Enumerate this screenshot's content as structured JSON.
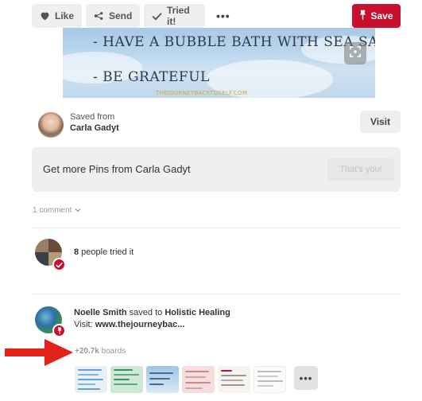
{
  "toolbar": {
    "like_label": "Like",
    "send_label": "Send",
    "tried_label": "Tried it!",
    "more_label": "•••",
    "save_label": "Save"
  },
  "pin_image": {
    "line1": "- HAVE A BUBBLE BATH WITH SEA SALT",
    "line2": "- BE GRATEFUL",
    "watermark": "THEJOURNEYBACKTOSELF.COM"
  },
  "saved_from": {
    "label": "Saved from",
    "name": "Carla Gadyt",
    "visit_label": "Visit"
  },
  "more_pins": {
    "text": "Get more Pins from Carla Gadyt",
    "button_label": "That's you!"
  },
  "comments": {
    "label": "1 comment"
  },
  "tried": {
    "count": "8",
    "suffix": " people tried it"
  },
  "activity": {
    "user": "Noelle Smith",
    "action": " saved to ",
    "board": "Holistic Healing",
    "visit_prefix": "Visit: ",
    "visit_url": "www.thejourneybac...",
    "boards_count": "+20.7k",
    "boards_suffix": " boards",
    "more_label": "•••"
  },
  "colors": {
    "accent_red": "#c8102e",
    "button_gray": "#efefef"
  },
  "icons": [
    "heart-icon",
    "send-icon",
    "checkmark-icon",
    "pin-icon",
    "expand-icon",
    "chevron-down-icon",
    "red-arrow"
  ]
}
